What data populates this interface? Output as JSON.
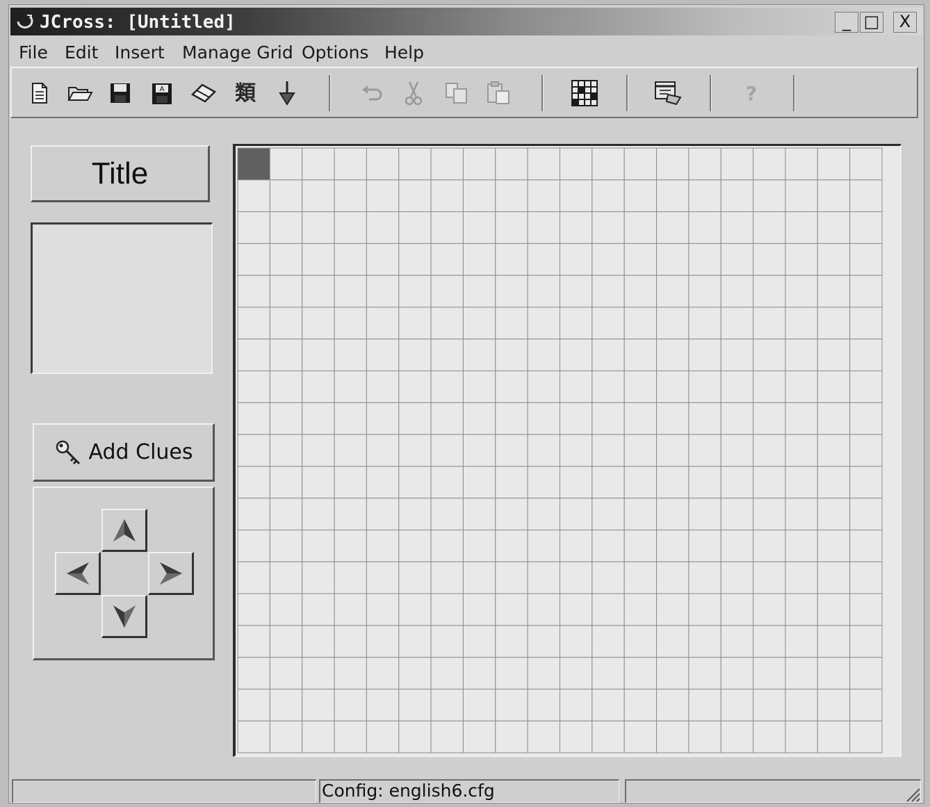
{
  "window": {
    "title": "JCross: [Untitled]",
    "controls": {
      "minimize": "_",
      "maximize": "□",
      "close": "X"
    }
  },
  "menu": {
    "items": [
      "File",
      "Edit",
      "Insert",
      "Manage Grid",
      "Options",
      "Help"
    ]
  },
  "toolbar": {
    "buttons": [
      {
        "icon": "new-file-icon",
        "enabled": true
      },
      {
        "icon": "open-folder-icon",
        "enabled": true
      },
      {
        "icon": "save-icon",
        "enabled": true
      },
      {
        "icon": "save-as-icon",
        "enabled": true
      },
      {
        "icon": "eraser-icon",
        "enabled": true
      },
      {
        "icon": "font-icon",
        "enabled": true
      },
      {
        "icon": "export-arrow-icon",
        "enabled": true
      },
      {
        "icon": "undo-icon",
        "enabled": false
      },
      {
        "icon": "cut-icon",
        "enabled": false
      },
      {
        "icon": "copy-icon",
        "enabled": false
      },
      {
        "icon": "paste-icon",
        "enabled": false
      },
      {
        "icon": "grid-icon",
        "enabled": true
      },
      {
        "icon": "web-page-icon",
        "enabled": true
      },
      {
        "icon": "help-icon",
        "enabled": false
      }
    ]
  },
  "left_panel": {
    "title_button": "Title",
    "add_clues_button": "Add Clues",
    "arrows": {
      "up": "up-arrow-icon",
      "left": "left-arrow-icon",
      "right": "right-arrow-icon",
      "down": "down-arrow-icon"
    }
  },
  "grid": {
    "rows": 19,
    "columns": 20,
    "selected_cell": {
      "row": 1,
      "column": 1
    },
    "colors": {
      "selected": "#606060",
      "line": "#8c8c8c",
      "background": "#e9e9e9"
    }
  },
  "status": {
    "left": "",
    "middle": "Config: english6.cfg",
    "right": ""
  }
}
